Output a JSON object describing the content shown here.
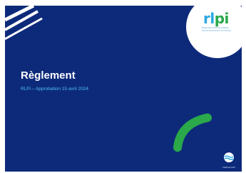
{
  "document": {
    "title": "Règlement",
    "subtitle": "RLPi – Approbation 15 avril 2024"
  },
  "logo": {
    "wordmark_main": "rl",
    "wordmark_accent": "pi",
    "tagline": "Règlement local de publicité intercommunal des communes"
  },
  "footer": {
    "org_logo_icon": "sea-wave-icon",
    "org_name": "FAMILLE COM"
  },
  "colors": {
    "background": "#0d2a7a",
    "accent_blue": "#29a8e0",
    "accent_green": "#2aa84a",
    "subtitle": "#4fc3f7"
  }
}
